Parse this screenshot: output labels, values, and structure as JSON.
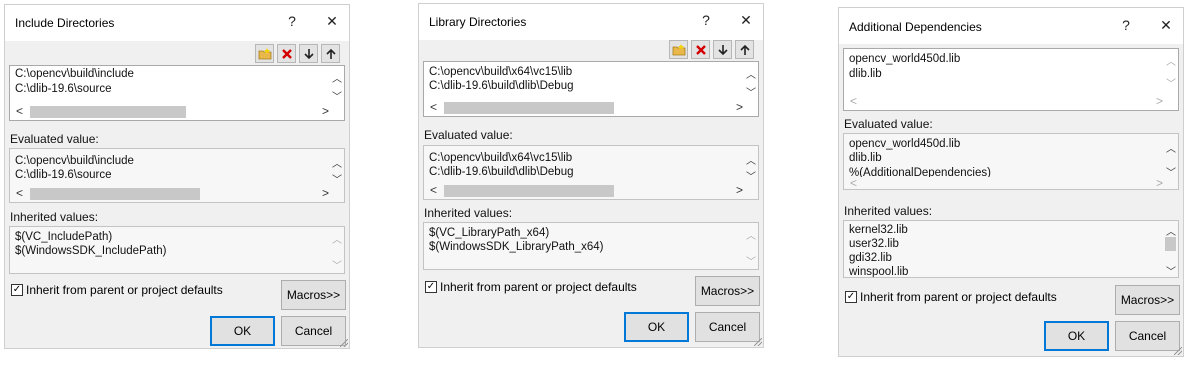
{
  "dialogs": [
    {
      "title": "Include Directories",
      "help": "?",
      "close": "✕",
      "edit_lines": [
        "C:\\opencv\\build\\include",
        "C:\\dlib-19.6\\source"
      ],
      "evaluated_label": "Evaluated value:",
      "evaluated_lines": [
        "C:\\opencv\\build\\include",
        "C:\\dlib-19.6\\source"
      ],
      "inherited_label": "Inherited values:",
      "inherited_lines": [
        "$(VC_IncludePath)",
        "$(WindowsSDK_IncludePath)"
      ],
      "inherit_checkbox": "Inherit from parent or project defaults",
      "macros": "Macros>>",
      "ok": "OK",
      "cancel": "Cancel"
    },
    {
      "title": "Library Directories",
      "help": "?",
      "close": "✕",
      "edit_lines": [
        "C:\\opencv\\build\\x64\\vc15\\lib",
        "C:\\dlib-19.6\\build\\dlib\\Debug"
      ],
      "evaluated_label": "Evaluated value:",
      "evaluated_lines": [
        "C:\\opencv\\build\\x64\\vc15\\lib",
        "C:\\dlib-19.6\\build\\dlib\\Debug"
      ],
      "inherited_label": "Inherited values:",
      "inherited_lines": [
        "$(VC_LibraryPath_x64)",
        "$(WindowsSDK_LibraryPath_x64)"
      ],
      "inherit_checkbox": "Inherit from parent or project defaults",
      "macros": "Macros>>",
      "ok": "OK",
      "cancel": "Cancel"
    },
    {
      "title": "Additional Dependencies",
      "help": "?",
      "close": "✕",
      "edit_lines": [
        "opencv_world450d.lib",
        "dlib.lib"
      ],
      "evaluated_label": "Evaluated value:",
      "evaluated_lines": [
        "opencv_world450d.lib",
        "dlib.lib",
        "%(AdditionalDependencies)"
      ],
      "inherited_label": "Inherited values:",
      "inherited_lines": [
        "kernel32.lib",
        "user32.lib",
        "gdi32.lib",
        "winspool.lib"
      ],
      "inherit_checkbox": "Inherit from parent or project defaults",
      "macros": "Macros>>",
      "ok": "OK",
      "cancel": "Cancel"
    }
  ],
  "icons": {
    "new_line": "new-folder-icon",
    "delete": "delete-icon",
    "move_down": "arrow-down-icon",
    "move_up": "arrow-up-icon",
    "accent": "#0078d7",
    "delete_color": "#d40000"
  }
}
